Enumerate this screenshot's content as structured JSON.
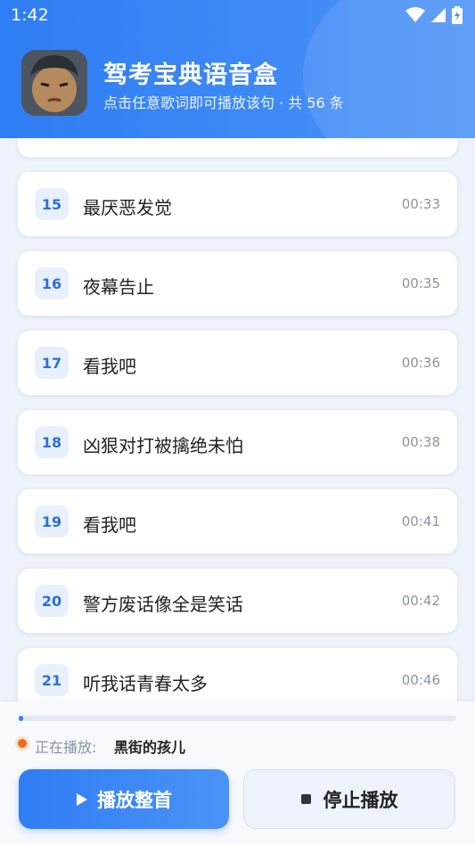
{
  "status": {
    "time": "1:42"
  },
  "header": {
    "title": "驾考宝典语音盒",
    "subtitle": "点击任意歌词即可播放该句 · 共 56 条"
  },
  "list": {
    "items": [
      {
        "num": "15",
        "text": "最厌恶发觉",
        "time": "00:33"
      },
      {
        "num": "16",
        "text": "夜幕告止",
        "time": "00:35"
      },
      {
        "num": "17",
        "text": "看我吧",
        "time": "00:36"
      },
      {
        "num": "18",
        "text": "凶狠对打被擒绝未怕",
        "time": "00:38"
      },
      {
        "num": "19",
        "text": "看我吧",
        "time": "00:41"
      },
      {
        "num": "20",
        "text": "警方废话像全是笑话",
        "time": "00:42"
      },
      {
        "num": "21",
        "text": "听我话青春太多",
        "time": "00:46"
      }
    ]
  },
  "player": {
    "progress": 0.01,
    "now_label": "正在播放:",
    "now_song": "黑街的孩儿",
    "play_label": "播放整首",
    "stop_label": "停止播放"
  }
}
